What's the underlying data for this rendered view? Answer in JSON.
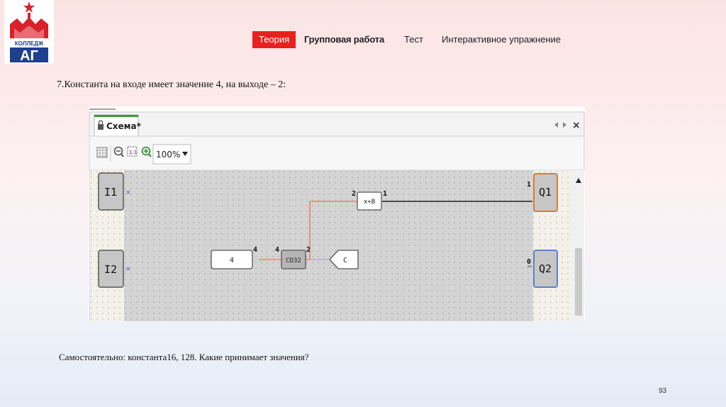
{
  "logo": {
    "text": "КОЛЛЕДЖ",
    "mark": "АГ",
    "colors": {
      "red": "#d8212b",
      "blue": "#1f3f8f"
    }
  },
  "nav": {
    "theory": "Теория",
    "group_work": "Групповая работа",
    "test": "Тест",
    "interactive": "Интерактивное упражнение",
    "accent": "#e8201e"
  },
  "task_text": "7.Константа на входе имеет значение 4, на выходе – 2:",
  "screenshot": {
    "tab_title": "Схема*",
    "zoom": "100%",
    "inputs": [
      "I1",
      "I2"
    ],
    "outputs": [
      "Q1",
      "Q2"
    ],
    "blocks": {
      "const": "4",
      "cd32": "CD32",
      "mult": "x+B",
      "c": "C"
    },
    "pins": {
      "const_out": "4",
      "cd32_in": "4",
      "cd32_out": "2",
      "mult_in": "2",
      "mult_out": "1",
      "q1_in": "1",
      "q2_in": "0"
    },
    "zoom_reset": "1:1",
    "close": "×"
  },
  "self_work_text": "Самостоятельно: константа16, 128. Какие принимает значения?",
  "page_number": "93"
}
